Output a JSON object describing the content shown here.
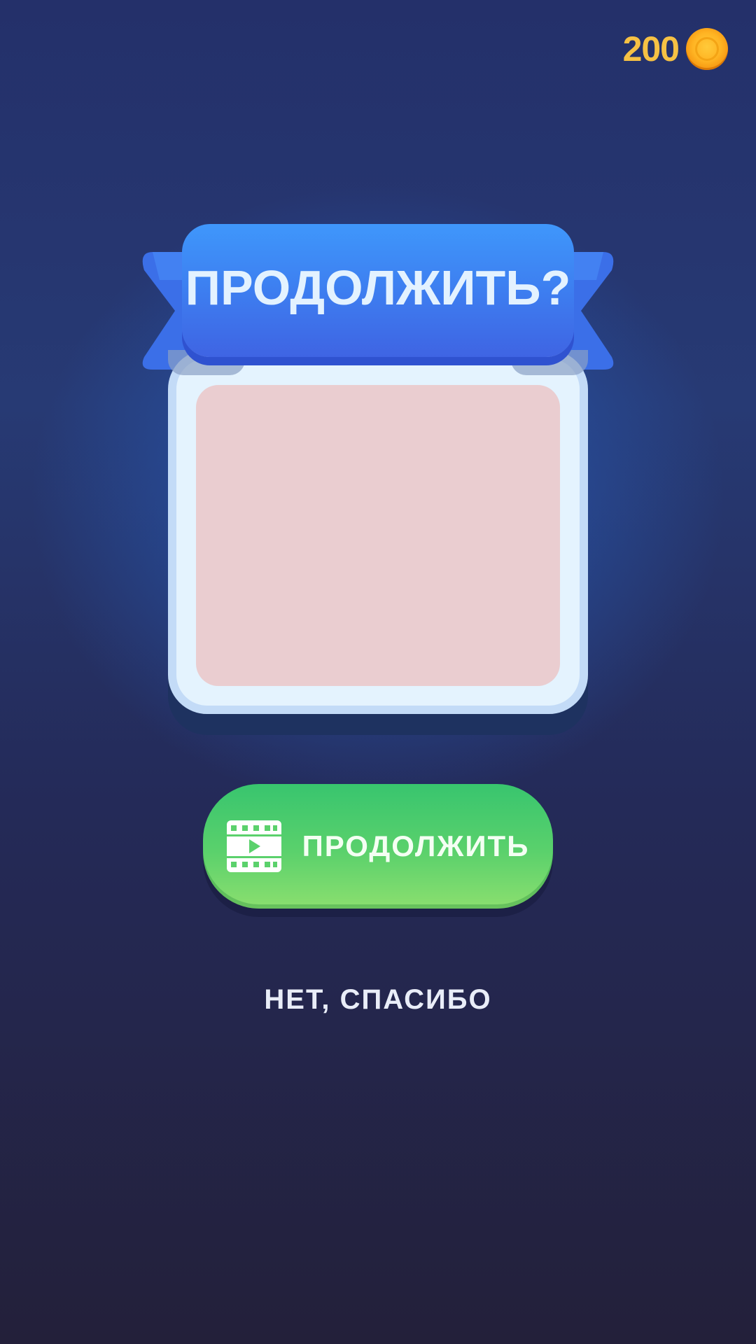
{
  "hud": {
    "coins": "200",
    "coin_icon": "coin-icon"
  },
  "dialog": {
    "title": "ПРОДОЛЖИТЬ?",
    "preview_color": "#eacdd0",
    "accent_blue": "#3d7ef0"
  },
  "actions": {
    "continue_label": "ПРОДОЛЖИТЬ",
    "continue_icon": "video-ad-icon",
    "continue_color": "#5bd16c",
    "decline_label": "НЕТ, СПАСИБО"
  }
}
